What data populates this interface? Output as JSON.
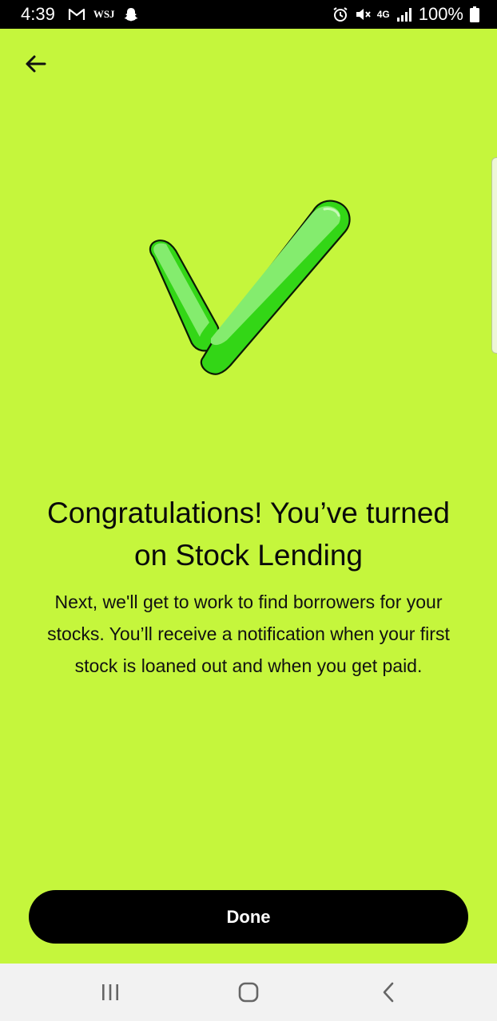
{
  "status_bar": {
    "time": "4:39",
    "wsj_label": "WSJ",
    "network_label": "4G",
    "battery": "100%",
    "icons": [
      "gmail-icon",
      "snapchat-icon",
      "alarm-icon",
      "mute-icon",
      "signal-icon",
      "battery-icon"
    ]
  },
  "colors": {
    "background": "#c5f63c",
    "button": "#000000",
    "check_fill": "#33d616",
    "check_highlight": "#7fe86a"
  },
  "header": {
    "back_icon": "arrow-left-icon"
  },
  "hero": {
    "icon": "checkmark-icon"
  },
  "content": {
    "title": "Congratulations! You’ve turned on Stock Lending",
    "body": "Next, we'll get to work to find borrowers for your stocks. You’ll receive a notification when your first stock is loaned out and when you get paid."
  },
  "actions": {
    "done_label": "Done"
  },
  "nav": {
    "icons": [
      "recent-apps-icon",
      "home-icon",
      "back-nav-icon"
    ]
  }
}
